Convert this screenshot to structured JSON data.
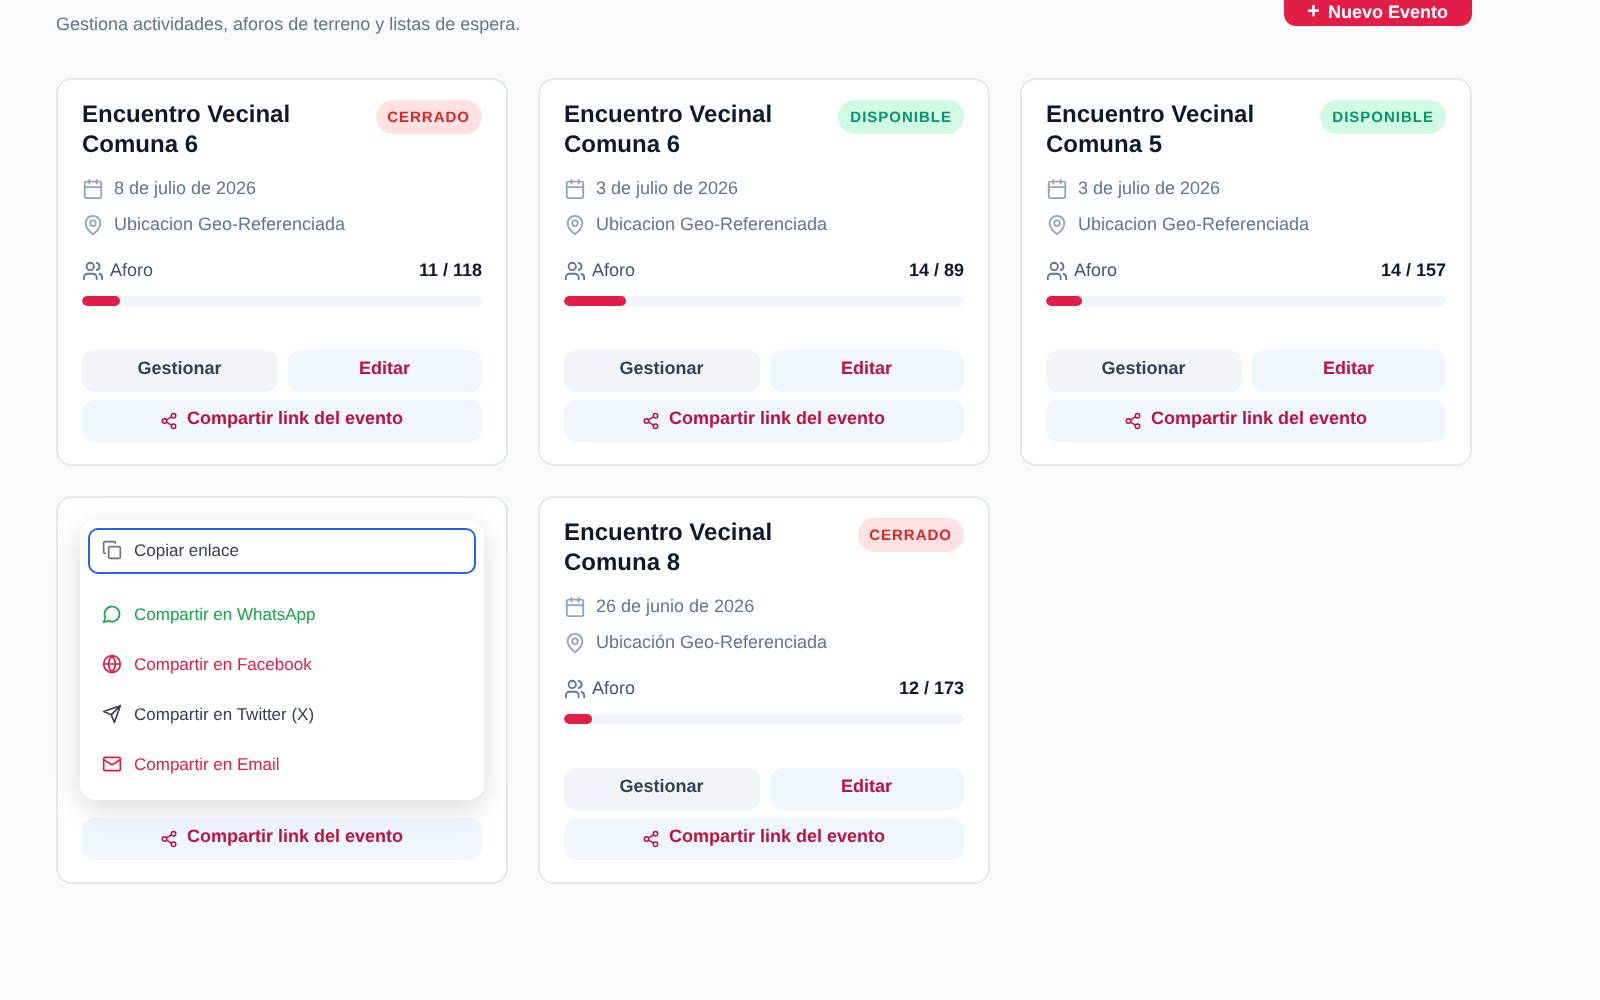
{
  "header": {
    "subtitle": "Gestiona actividades, aforos de terreno y listas de espera.",
    "new_button": {
      "icon": "+",
      "label": "Nuevo Evento"
    }
  },
  "cards": [
    {
      "title": "Encuentro Vecinal Comuna 6",
      "status": {
        "kind": "closed",
        "label": "CERRADO"
      },
      "date": "8 de julio de 2026",
      "location": "Ubicacion Geo-Referenciada",
      "capacity_label": "Aforo",
      "capacity": "11 / 118",
      "level": 0.093,
      "actions": [
        "Gestionar",
        "Editar"
      ],
      "share": "Compartir link del evento"
    },
    {
      "title": "Encuentro Vecinal Comuna 6",
      "status": {
        "kind": "available",
        "label": "DISPONIBLE"
      },
      "date": "3 de julio de 2026",
      "location": "Ubicacion Geo-Referenciada",
      "capacity_label": "Aforo",
      "capacity": "14 / 89",
      "level": 0.157,
      "actions": [
        "Gestionar",
        "Editar"
      ],
      "share": "Compartir link del evento"
    },
    {
      "title": "Encuentro Vecinal Comuna 5",
      "status": {
        "kind": "available",
        "label": "DISPONIBLE"
      },
      "date": "3 de julio de 2026",
      "location": "Ubicacion Geo-Referenciada",
      "capacity_label": "Aforo",
      "capacity": "14 / 157",
      "level": 0.089,
      "actions": [
        "Gestionar",
        "Editar"
      ],
      "share": "Compartir link del evento"
    },
    {
      "share": "Compartir link del evento",
      "share_menu": [
        {
          "kind": "copy",
          "label": "Copiar enlace",
          "color": "#374151",
          "selected": true
        },
        {
          "kind": "whatsapp",
          "label": "Compartir en WhatsApp",
          "color": "#16a34a",
          "selected": false
        },
        {
          "kind": "facebook",
          "label": "Compartir en Facebook",
          "color": "#e11d48",
          "selected": false
        },
        {
          "kind": "twitter",
          "label": "Compartir en Twitter (X)",
          "color": "#374151",
          "selected": false
        },
        {
          "kind": "email",
          "label": "Compartir en Email",
          "color": "#e11d48",
          "selected": false
        }
      ]
    },
    {
      "title": "Encuentro Vecinal Comuna 8",
      "status": {
        "kind": "closed",
        "label": "CERRADO"
      },
      "date": "26 de junio de 2026",
      "location": "Ubicación Geo-Referenciada",
      "capacity_label": "Aforo",
      "capacity": "12 / 173",
      "level": 0.069,
      "actions": [
        "Gestionar",
        "Editar"
      ],
      "share": "Compartir link del evento"
    }
  ]
}
